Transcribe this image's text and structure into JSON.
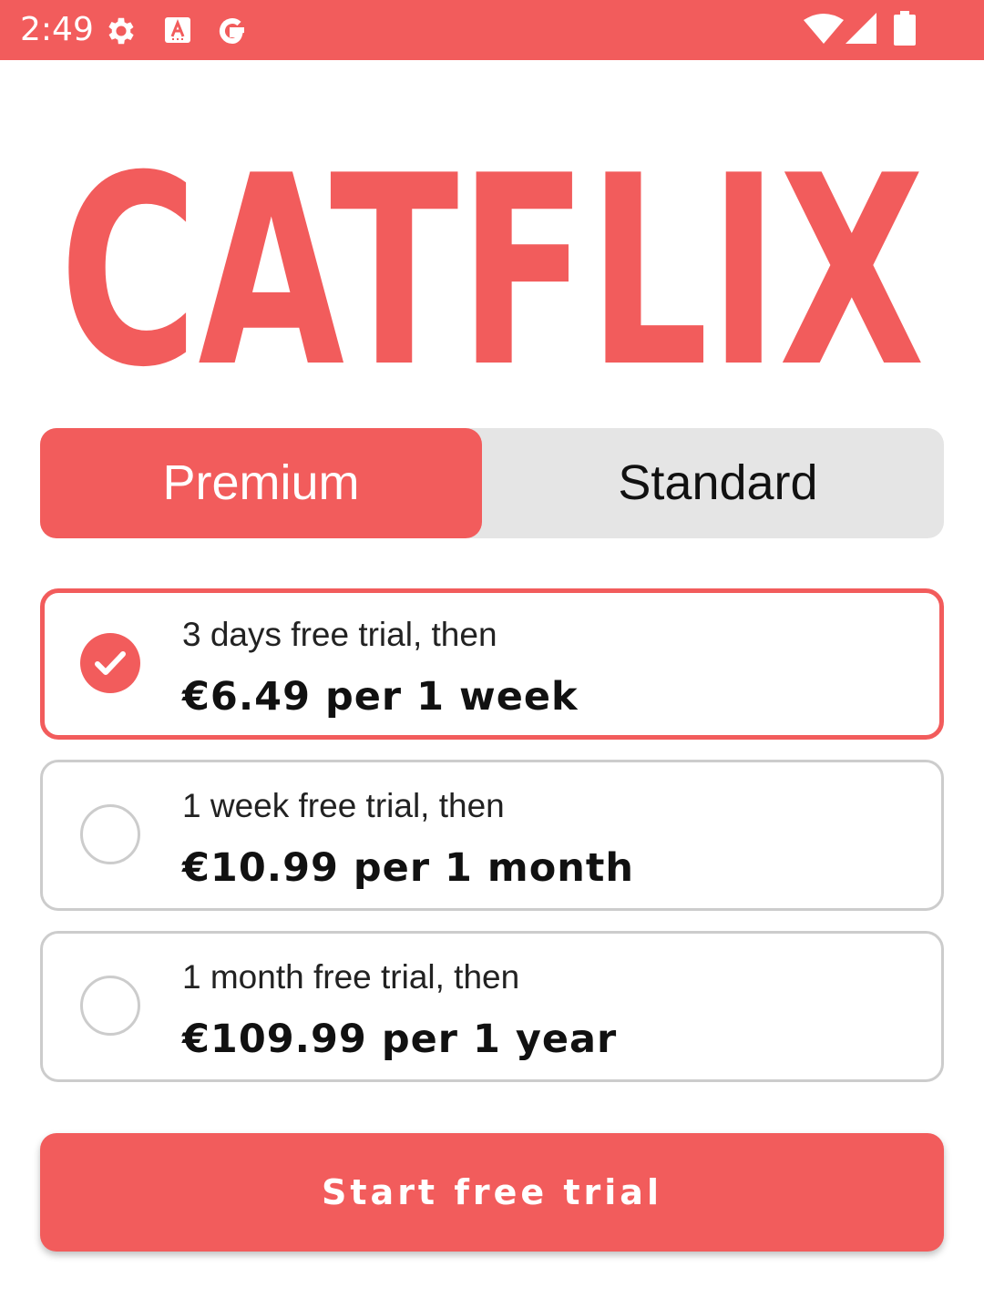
{
  "colors": {
    "brand": "#F25C5C",
    "segment_bg": "#E5E5E5",
    "border_unselected": "#CCCCCC"
  },
  "status_bar": {
    "time": "2:49",
    "left_icons": [
      "settings-icon",
      "keyboard-a-icon",
      "google-g-icon"
    ],
    "right_icons": [
      "wifi-icon",
      "signal-icon",
      "battery-icon"
    ]
  },
  "logo": {
    "text": "CATFLIX"
  },
  "tabs": {
    "selected": "premium",
    "premium_label": "Premium",
    "standard_label": "Standard"
  },
  "plans": [
    {
      "trial": "3 days free trial, then",
      "price": "€6.49 per 1 week",
      "selected": true
    },
    {
      "trial": "1 week free trial, then",
      "price": "€10.99 per 1 month",
      "selected": false
    },
    {
      "trial": "1 month free trial, then",
      "price": "€109.99 per 1 year",
      "selected": false
    }
  ],
  "cta": {
    "label": "Start free trial"
  }
}
